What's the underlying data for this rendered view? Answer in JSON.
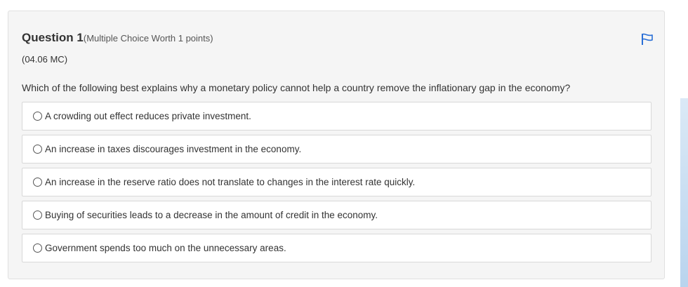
{
  "question": {
    "title": "Question 1",
    "worth": "(Multiple Choice Worth 1 points)",
    "code": "(04.06 MC)",
    "prompt": "Which of the following best explains why a monetary policy cannot help a country remove the inflationary gap in the economy?",
    "flag_icon": "flag-icon",
    "accent_color": "#2a6fd6"
  },
  "options": [
    {
      "label": "A crowding out effect reduces private investment.",
      "selected": false
    },
    {
      "label": "An increase in taxes discourages investment in the economy.",
      "selected": false
    },
    {
      "label": "An increase in the reserve ratio does not translate to changes in the interest rate quickly.",
      "selected": false
    },
    {
      "label": "Buying of securities leads to a decrease in the amount of credit in the economy.",
      "selected": false
    },
    {
      "label": "Government spends too much on the unnecessary areas.",
      "selected": false
    }
  ]
}
